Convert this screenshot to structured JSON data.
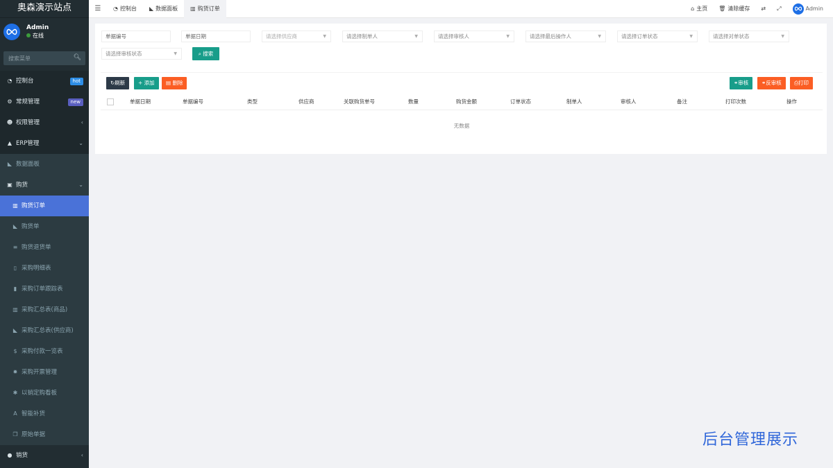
{
  "sidebar": {
    "logo": "奥森演示站点",
    "user": {
      "name": "Admin",
      "status": "在线"
    },
    "search_placeholder": "搜索菜单",
    "items": [
      {
        "label": "控制台",
        "icon": "dashboard-icon",
        "badge": "hot"
      },
      {
        "label": "常规管理",
        "icon": "cogs-icon",
        "badge": "new"
      },
      {
        "label": "权限管理",
        "icon": "group-icon",
        "chevron": "‹"
      },
      {
        "label": "ERP管理",
        "icon": "graduation-cap-icon",
        "chevron": "⌄"
      },
      {
        "label": "数据面板",
        "icon": "area-chart-icon"
      },
      {
        "label": "购货",
        "icon": "shopping-bag-icon",
        "chevron": "⌄"
      },
      {
        "label": "购货订单",
        "icon": "bar-chart-icon"
      },
      {
        "label": "购货单",
        "icon": "area-chart-icon"
      },
      {
        "label": "购货退货单",
        "icon": "database-icon"
      },
      {
        "label": "采购明细表",
        "icon": "file-icon"
      },
      {
        "label": "采购订单跟踪表",
        "icon": "book-icon"
      },
      {
        "label": "采购汇总表(商品)",
        "icon": "bar-chart-icon"
      },
      {
        "label": "采购汇总表(供应商)",
        "icon": "area-chart-icon"
      },
      {
        "label": "采购付款一览表",
        "icon": "dollar-icon"
      },
      {
        "label": "采购开票管理",
        "icon": "gear-icon"
      },
      {
        "label": "以销定购看板",
        "icon": "asterisk-icon"
      },
      {
        "label": "智能补货",
        "icon": "font-icon"
      },
      {
        "label": "原始单据",
        "icon": "files-icon"
      },
      {
        "label": "销货",
        "icon": "apple-icon",
        "chevron": "‹"
      }
    ]
  },
  "topbar": {
    "tabs": [
      {
        "label": "控制台"
      },
      {
        "label": "数据面板"
      },
      {
        "label": "购货订单"
      }
    ],
    "right": {
      "home": "主页",
      "clear_cache": "清除缓存",
      "admin": "Admin"
    }
  },
  "filters": {
    "doc_no": "单据编号",
    "doc_date": "单据日期",
    "supplier": "请选择供应商",
    "creator": "请选择制单人",
    "auditor": "请选择审核人",
    "last_operator": "请选择最后操作人",
    "order_status": "请选择订单状态",
    "reconcile_status": "请选择对单状态",
    "audit_status": "请选择审核状态",
    "search": "搜索"
  },
  "toolbar": {
    "refresh": "刷新",
    "add": "添加",
    "delete": "删除",
    "audit": "审核",
    "unaudit": "反审核",
    "print": "打印"
  },
  "table": {
    "columns": [
      "单据日期",
      "单据编号",
      "类型",
      "供应商",
      "关联购货单号",
      "数量",
      "购货金额",
      "订单状态",
      "制单人",
      "审核人",
      "备注",
      "打印次数",
      "操作"
    ],
    "empty": "无数据"
  },
  "watermark": "后台管理展示",
  "colors": {
    "sidebar_bg": "#222d32",
    "active": "#4a72d8",
    "teal": "#189d8a",
    "orange": "#fb5e24",
    "dark": "#2d3a48"
  }
}
